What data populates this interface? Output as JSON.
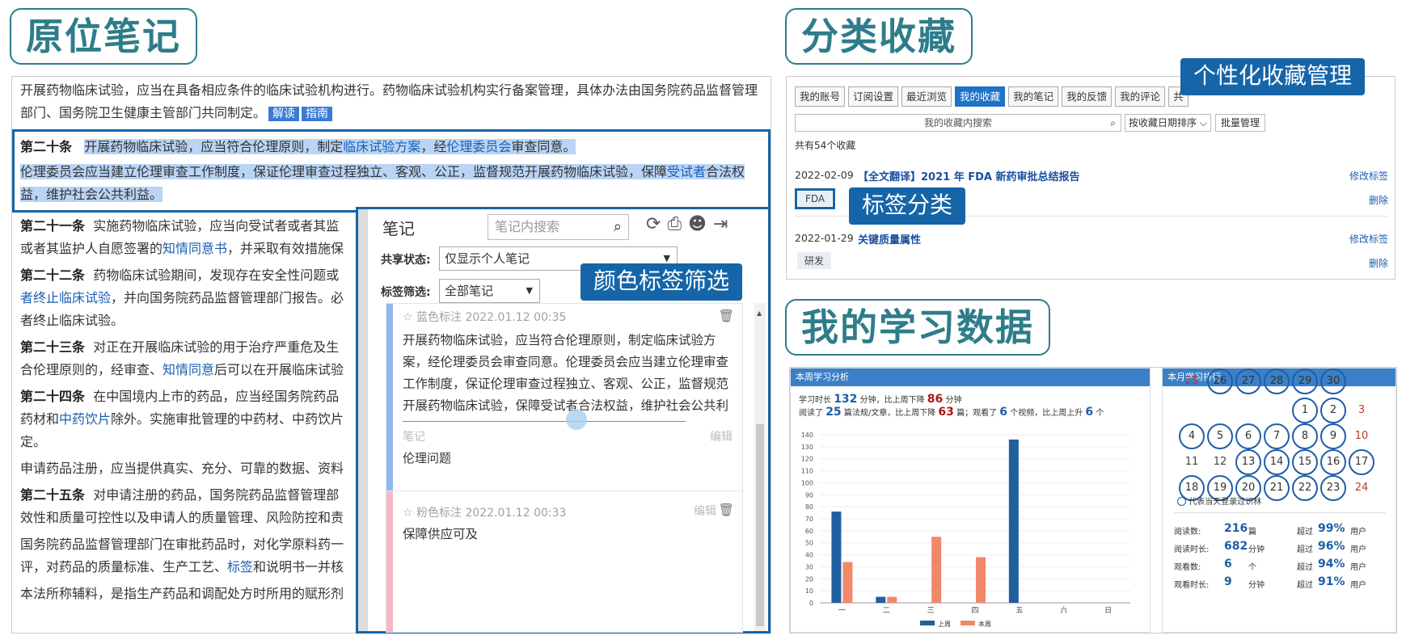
{
  "sections": {
    "inline_notes": "原位笔记",
    "collections": "分类收藏",
    "study_data": "我的学习数据"
  },
  "callouts": {
    "color_filter": "颜色标签筛选",
    "personal_fav": "个性化收藏管理",
    "tag_classify": "标签分类"
  },
  "article": {
    "p0": "开展药物临床试验，应当在具备相应条件的临床试验机构进行。药物临床试验机构实行备案管理，具体办法由国务院药品监督管理部门、国务院卫生健康主管部门共同制定。",
    "tag_read": "解读",
    "tag_guide": "指南",
    "a20_no": "第二十条",
    "a20_a": "开展药物临床试验，应当符合伦理原则，制定",
    "a20_l1": "临床试验方案",
    "a20_b": "，经",
    "a20_l2": "伦理委员会",
    "a20_c": "审查同意。",
    "a20_p2a": "伦理委员会应当建立伦理审查工作制度，保证伦理审查过程独立、客观、公正，监督规范开展药物临床试验，保障",
    "a20_p2l": "受试者",
    "a20_p2b": "合法权益，维护社会公共利益。",
    "a21_no": "第二十一条",
    "a21_a": "实施药物临床试验，应当向受试者或者其监",
    "a21_b": "或者其监护人自愿签署的",
    "a21_l": "知情同意书",
    "a21_c": "，并采取有效措施保",
    "a22_no": "第二十二条",
    "a22_a": "药物临床试验期间，发现存在安全性问题或",
    "a22_l": "者终止临床试验",
    "a22_b": "，并向国务院药品监督管理部门报告。必",
    "a22_c": "者终止临床试验。",
    "a23_no": "第二十三条",
    "a23_a": "对正在开展临床试验的用于治疗严重危及生",
    "a23_b": "合伦理原则的，经审查、",
    "a23_l": "知情同意",
    "a23_c": "后可以在开展临床试验",
    "a24_no": "第二十四条",
    "a24_a": "在中国境内上市的药品，应当经国务院药品",
    "a24_b": "药材和",
    "a24_l": "中药饮片",
    "a24_c": "除外。实施审批管理的中药材、中药饮片",
    "a24_d": "定。",
    "p_reg": "申请药品注册，应当提供真实、充分、可靠的数据、资料",
    "a25_no": "第二十五条",
    "a25_a": "对申请注册的药品，国务院药品监督管理部",
    "a25_b": "效性和质量可控性以及申请人的质量管理、风险防控和责",
    "p_nmpa_a": "国务院药品监督管理部门在审批药品时，对化学原料药一",
    "p_nmpa_b": "评，对药品的质量标准、生产工艺、",
    "p_nmpa_l": "标签",
    "p_nmpa_c": "和说明书一并核",
    "p_exc": "本法所称辅料，是指生产药品和调配处方时所用的赋形剂"
  },
  "notes": {
    "title": "笔记",
    "search_placeholder": "笔记内搜索",
    "share_label": "共享状态:",
    "share_value": "仅显示个人笔记",
    "tag_label": "标签筛选:",
    "tag_value": "全部笔记",
    "card1": {
      "color": "#8fb8f0",
      "meta": "蓝色标注 2022.01.12 00:35",
      "text": "开展药物临床试验，应当符合伦理原则，制定临床试验方案，经伦理委员会审查同意。伦理委员会应当建立伦理审查工作制度，保证伦理审查过程独立、客观、公正，监督规范开展药物临床试验，保障受试者合法权益，维护社会公共利益。",
      "note_label": "笔记",
      "edit": "编辑",
      "note": "伦理问题"
    },
    "card2": {
      "color": "#f5b8c4",
      "meta": "粉色标注 2022.01.12 00:33",
      "edit": "编辑",
      "text": "保障供应可及"
    }
  },
  "fav": {
    "tabs": [
      "我的账号",
      "订阅设置",
      "最近浏览",
      "我的收藏",
      "我的笔记",
      "我的反馈",
      "我的评论",
      "共"
    ],
    "active_tab": "我的收藏",
    "search_placeholder": "我的收藏内搜索",
    "sort": "按收藏日期排序",
    "batch": "批量管理",
    "count": "共有54个收藏",
    "items": [
      {
        "date": "2022-02-09",
        "title": "【全文翻译】2021 年 FDA 新药审批总结报告",
        "tag": "FDA",
        "edit": "修改标签",
        "del": "删除"
      },
      {
        "date": "2022-01-29",
        "title": "关键质量属性",
        "tag": "研发",
        "edit": "修改标签",
        "del": "删除"
      }
    ]
  },
  "weekly": {
    "title": "本周学习分析",
    "l1_a": "学习时长",
    "l1_v1": "132",
    "l1_b": "分钟，比上周下降",
    "l1_v2": "86",
    "l1_c": "分钟",
    "l2_a": "阅读了",
    "l2_v1": "25",
    "l2_b": "篇法规/文章，比上周下降",
    "l2_v2": "63",
    "l2_c": "篇；观看了",
    "l2_v3": "6",
    "l2_d": "个视频，比上周上升",
    "l2_v4": "6",
    "l2_e": "个",
    "legend_last": "上周",
    "legend_this": "本周"
  },
  "chart_data": {
    "type": "bar",
    "categories": [
      "一",
      "二",
      "三",
      "四",
      "五",
      "六",
      "日"
    ],
    "series": [
      {
        "name": "上周",
        "color": "#1f5fa0",
        "values": [
          76,
          5,
          0,
          0,
          136,
          0,
          0
        ]
      },
      {
        "name": "本周",
        "color": "#f0886a",
        "values": [
          34,
          5,
          55,
          38,
          0,
          0,
          0
        ]
      }
    ],
    "ylim": [
      0,
      140
    ],
    "yticks": [
      0,
      10,
      20,
      30,
      40,
      50,
      60,
      70,
      80,
      90,
      100,
      110,
      120,
      130,
      140
    ]
  },
  "monthly": {
    "title": "本月学习排行",
    "legend": "代表当天登录过识林",
    "stats": [
      {
        "label": "阅读数:",
        "value": "216",
        "unit": "篇",
        "beat_a": "超过",
        "pct": "99%",
        "beat_b": "用户"
      },
      {
        "label": "阅读时长:",
        "value": "682",
        "unit": "分钟",
        "beat_a": "超过",
        "pct": "96%",
        "beat_b": "用户"
      },
      {
        "label": "观看数:",
        "value": "6",
        "unit": "个",
        "beat_a": "超过",
        "pct": "94%",
        "beat_b": "用户"
      },
      {
        "label": "观看时长:",
        "value": "9",
        "unit": "分钟",
        "beat_a": "超过",
        "pct": "91%",
        "beat_b": "用户"
      }
    ]
  }
}
